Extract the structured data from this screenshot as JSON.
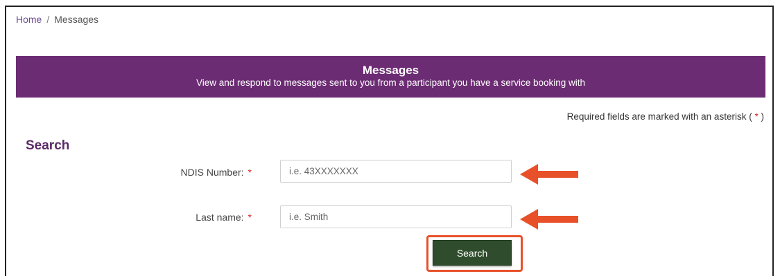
{
  "breadcrumb": {
    "home": "Home",
    "separator": "/",
    "current": "Messages"
  },
  "banner": {
    "title": "Messages",
    "subtitle": "View and respond to messages sent to you from a participant you have a service booking with"
  },
  "required_note": {
    "prefix": "Required fields are marked with an asterisk (",
    "star": "*",
    "suffix": ")"
  },
  "search": {
    "heading": "Search",
    "ndis_label": "NDIS Number:",
    "ndis_placeholder": "i.e. 43XXXXXXX",
    "lastname_label": "Last name:",
    "lastname_placeholder": "i.e. Smith",
    "required_star": "*",
    "button_label": "Search"
  },
  "colors": {
    "banner_bg": "#6c2c73",
    "button_bg": "#2f4d2c",
    "annotation_arrow": "#e8502a",
    "required_star": "#d22a2a"
  },
  "icons": {
    "annotation_arrow": "left-arrow-icon"
  }
}
